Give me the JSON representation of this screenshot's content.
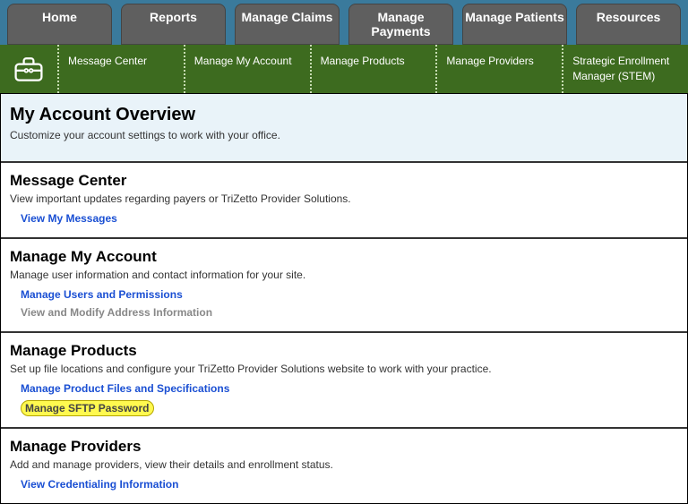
{
  "tabs": {
    "home": "Home",
    "reports": "Reports",
    "claims": "Manage Claims",
    "payments": "Manage Payments",
    "patients": "Manage Patients",
    "resources": "Resources"
  },
  "subnav": {
    "message_center": "Message Center",
    "manage_account": "Manage My Account",
    "manage_products": "Manage Products",
    "manage_providers": "Manage Providers",
    "stem": "Strategic Enrollment Manager (STEM)"
  },
  "overview": {
    "title": "My Account Overview",
    "desc": "Customize your account settings to work with your office."
  },
  "sections": {
    "message_center": {
      "title": "Message Center",
      "desc": "View important updates regarding payers or TriZetto Provider Solutions.",
      "link1": "View My Messages"
    },
    "manage_account": {
      "title": "Manage My Account",
      "desc": "Manage user information and contact information for your site.",
      "link1": "Manage Users and Permissions",
      "link2": "View and Modify Address Information"
    },
    "manage_products": {
      "title": "Manage Products",
      "desc": "Set up file locations and configure your TriZetto Provider Solutions website to work with your practice.",
      "link1": "Manage Product Files and Specifications",
      "link2": "Manage SFTP Password"
    },
    "manage_providers": {
      "title": "Manage Providers",
      "desc": "Add and manage providers, view their details and enrollment status.",
      "link1": "View Credentialing Information"
    }
  }
}
